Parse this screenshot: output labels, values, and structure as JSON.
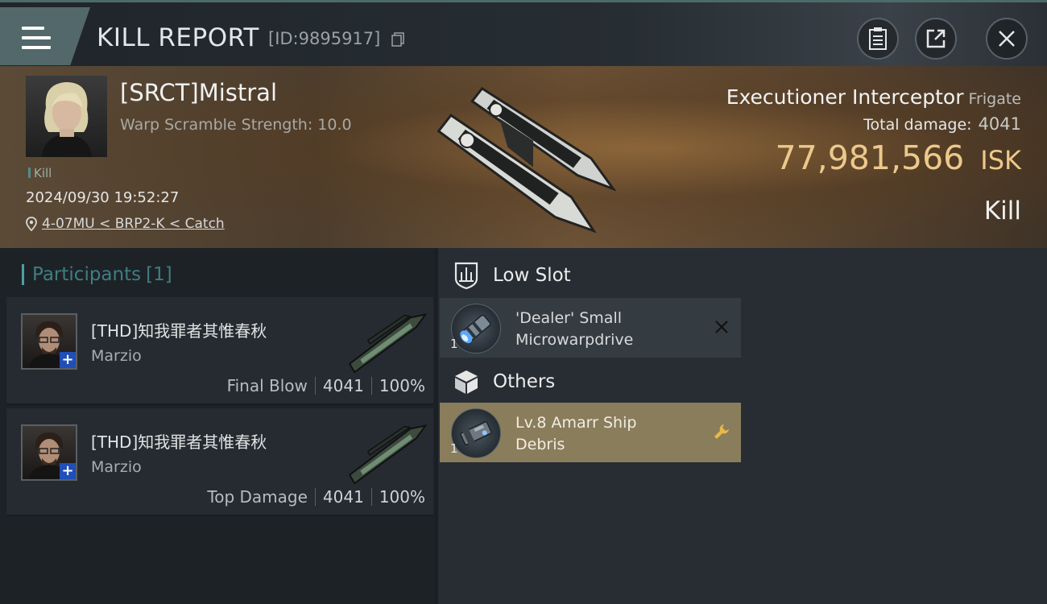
{
  "header": {
    "title": "KILL REPORT",
    "report_id": "[ID:9895917]",
    "buttons": {
      "clipboard": "clipboard-icon",
      "share": "share-icon",
      "close": "close-icon"
    }
  },
  "victim": {
    "name": "[SRCT]Mistral",
    "scramble": "Warp Scramble Strength: 10.0",
    "tag": "Kill",
    "timestamp": "2024/09/30 19:52:27",
    "location": "4-07MU < BRP2-K < Catch",
    "ship": "Executioner Interceptor",
    "ship_class": "Frigate",
    "total_damage_label": "Total damage:",
    "total_damage": "4041",
    "isk_value": "77,981,566",
    "isk_unit": "ISK",
    "result": "Kill"
  },
  "participants": {
    "label": "Participants",
    "count": "[1]",
    "rows": [
      {
        "corp": "[THD]知我罪者其惟春秋",
        "name": "Marzio",
        "role": "Final Blow",
        "damage": "4041",
        "percent": "100%"
      },
      {
        "corp": "[THD]知我罪者其惟春秋",
        "name": "Marzio",
        "role": "Top Damage",
        "damage": "4041",
        "percent": "100%"
      }
    ]
  },
  "slots": {
    "low": {
      "label": "Low Slot",
      "items": [
        {
          "qty": "1",
          "name_line1": "'Dealer' Small",
          "name_line2": "Microwarpdrive",
          "status": "destroyed"
        }
      ]
    },
    "others": {
      "label": "Others",
      "items": [
        {
          "qty": "1",
          "name_line1": "Lv.8 Amarr Ship",
          "name_line2": "Debris",
          "status": "dropped"
        }
      ]
    }
  },
  "colors": {
    "accent": "#4f9ea0",
    "isk": "#ecc98b",
    "debris_highlight": "#8a7d5c",
    "tool_icon": "#e8b84a"
  }
}
